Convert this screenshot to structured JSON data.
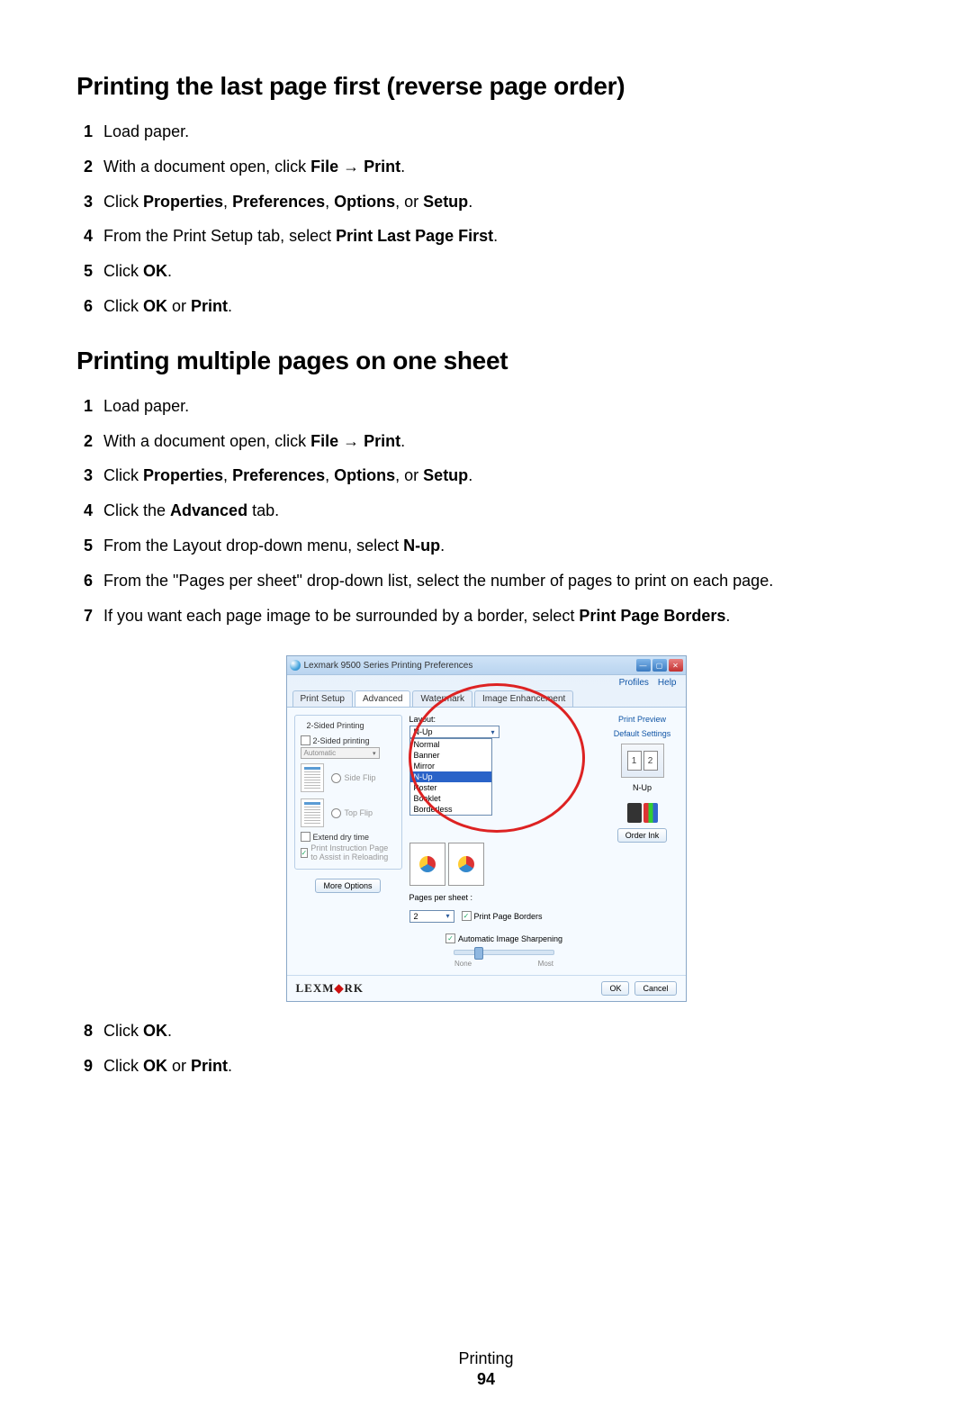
{
  "section1": {
    "heading": "Printing the last page first (reverse page order)",
    "steps": [
      {
        "num": "1",
        "parts": [
          {
            "t": "Load paper."
          }
        ]
      },
      {
        "num": "2",
        "parts": [
          {
            "t": "With a document open, click "
          },
          {
            "b": "File"
          },
          {
            "t": " "
          },
          {
            "arrow": "→"
          },
          {
            "t": " "
          },
          {
            "b": "Print"
          },
          {
            "t": "."
          }
        ]
      },
      {
        "num": "3",
        "parts": [
          {
            "t": "Click "
          },
          {
            "b": "Properties"
          },
          {
            "t": ", "
          },
          {
            "b": "Preferences"
          },
          {
            "t": ", "
          },
          {
            "b": "Options"
          },
          {
            "t": ", or "
          },
          {
            "b": "Setup"
          },
          {
            "t": "."
          }
        ]
      },
      {
        "num": "4",
        "parts": [
          {
            "t": "From the Print Setup tab, select "
          },
          {
            "b": "Print Last Page First"
          },
          {
            "t": "."
          }
        ]
      },
      {
        "num": "5",
        "parts": [
          {
            "t": "Click "
          },
          {
            "b": "OK"
          },
          {
            "t": "."
          }
        ]
      },
      {
        "num": "6",
        "parts": [
          {
            "t": "Click "
          },
          {
            "b": "OK"
          },
          {
            "t": " or "
          },
          {
            "b": "Print"
          },
          {
            "t": "."
          }
        ]
      }
    ]
  },
  "section2": {
    "heading": "Printing multiple pages on one sheet",
    "steps_a": [
      {
        "num": "1",
        "parts": [
          {
            "t": "Load paper."
          }
        ]
      },
      {
        "num": "2",
        "parts": [
          {
            "t": "With a document open, click "
          },
          {
            "b": "File"
          },
          {
            "t": " "
          },
          {
            "arrow": "→"
          },
          {
            "t": " "
          },
          {
            "b": "Print"
          },
          {
            "t": "."
          }
        ]
      },
      {
        "num": "3",
        "parts": [
          {
            "t": "Click "
          },
          {
            "b": "Properties"
          },
          {
            "t": ", "
          },
          {
            "b": "Preferences"
          },
          {
            "t": ", "
          },
          {
            "b": "Options"
          },
          {
            "t": ", or "
          },
          {
            "b": "Setup"
          },
          {
            "t": "."
          }
        ]
      },
      {
        "num": "4",
        "parts": [
          {
            "t": "Click the "
          },
          {
            "b": "Advanced"
          },
          {
            "t": " tab."
          }
        ]
      },
      {
        "num": "5",
        "parts": [
          {
            "t": "From the Layout drop-down menu, select "
          },
          {
            "b": "N-up"
          },
          {
            "t": "."
          }
        ]
      },
      {
        "num": "6",
        "parts": [
          {
            "t": "From the \"Pages per sheet\" drop-down list, select the number of pages to print on each page."
          }
        ]
      },
      {
        "num": "7",
        "parts": [
          {
            "t": "If you want each page image to be surrounded by a border, select "
          },
          {
            "b": "Print Page Borders"
          },
          {
            "t": "."
          }
        ]
      }
    ],
    "steps_b": [
      {
        "num": "8",
        "parts": [
          {
            "t": "Click "
          },
          {
            "b": "OK"
          },
          {
            "t": "."
          }
        ]
      },
      {
        "num": "9",
        "parts": [
          {
            "t": "Click "
          },
          {
            "b": "OK"
          },
          {
            "t": " or "
          },
          {
            "b": "Print"
          },
          {
            "t": "."
          }
        ]
      }
    ]
  },
  "dialog": {
    "title": "Lexmark 9500 Series Printing Preferences",
    "menu": {
      "profiles": "Profiles",
      "help": "Help"
    },
    "tabs": [
      "Print Setup",
      "Advanced",
      "Watermark",
      "Image Enhancement"
    ],
    "active_tab": "Advanced",
    "left": {
      "group1_title": "2-Sided Printing",
      "chk_2sided": "2-Sided printing",
      "auto": "Automatic",
      "side_flip": "Side Flip",
      "top_flip": "Top Flip",
      "extend_dry": "Extend dry time",
      "print_instr": "Print Instruction Page to Assist in Reloading",
      "more_options": "More Options"
    },
    "mid": {
      "layout_label": "Layout:",
      "layout_value": "N-Up",
      "options": [
        "Normal",
        "Banner",
        "Mirror",
        "N-Up",
        "Poster",
        "Booklet",
        "Borderless"
      ],
      "pps_label": "Pages per sheet :",
      "pps_value": "2",
      "print_borders": "Print Page Borders",
      "auto_sharpen": "Automatic Image Sharpening",
      "slider_min": "None",
      "slider_max": "Most"
    },
    "right": {
      "preview": "Print Preview",
      "defaults": "Default Settings",
      "nup_caption": "N-Up",
      "order_ink": "Order Ink"
    },
    "footer": {
      "brand_pre": "LEXM",
      "brand_diamond": "◆",
      "brand_post": "RK",
      "ok": "OK",
      "cancel": "Cancel"
    }
  },
  "page_footer": {
    "section": "Printing",
    "number": "94"
  }
}
